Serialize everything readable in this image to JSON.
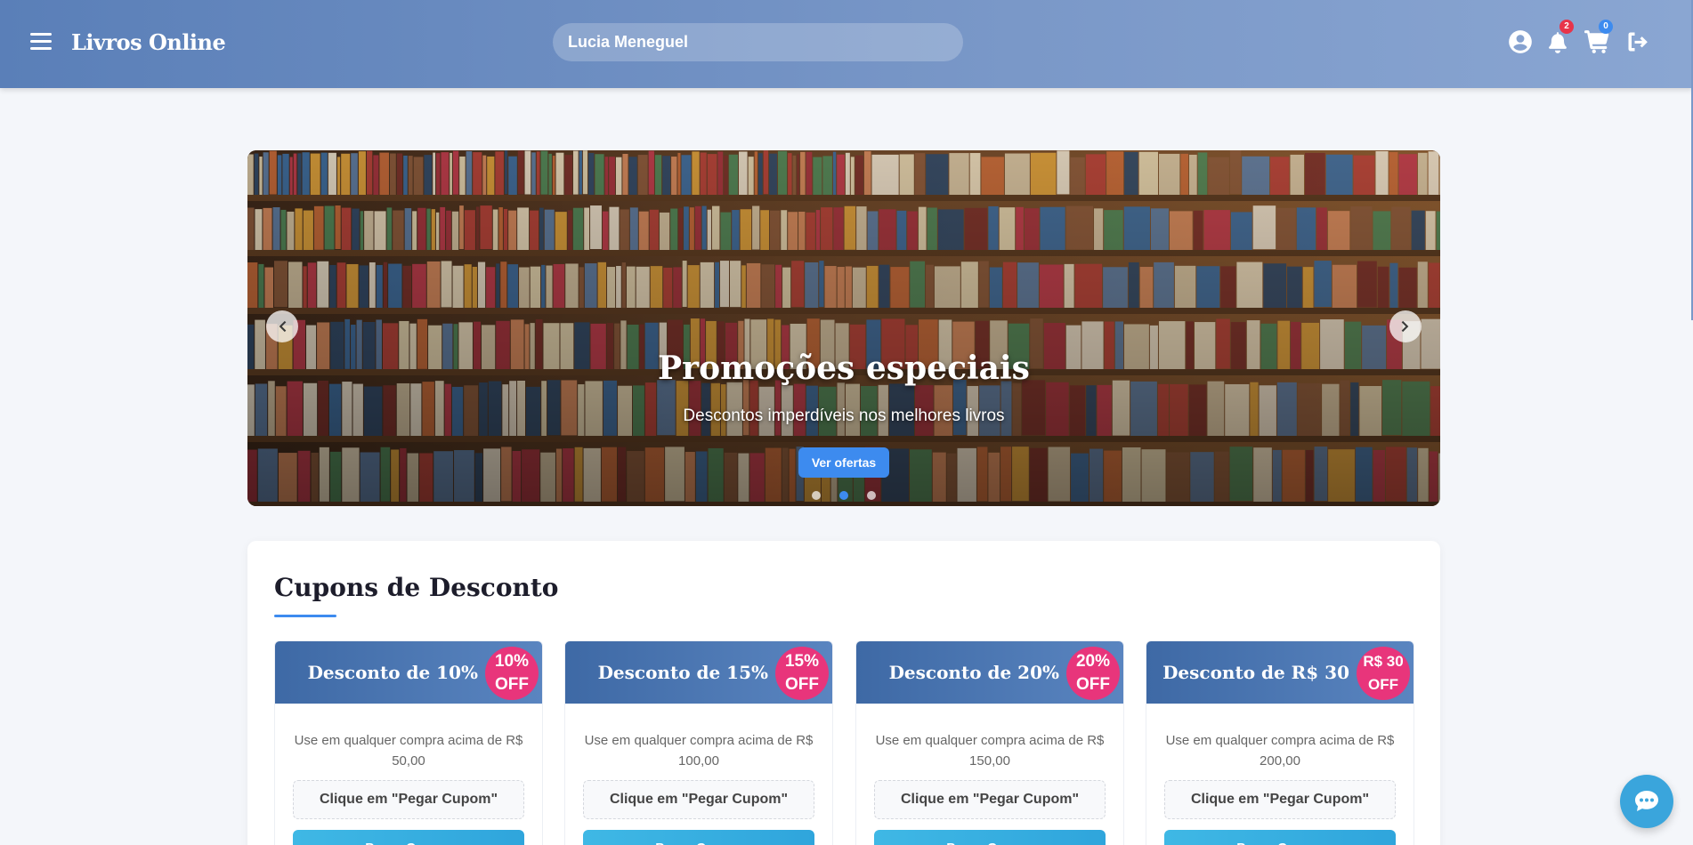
{
  "header": {
    "brand": "Livros Online",
    "search_value": "Lucia Meneguel",
    "notifications_count": "2",
    "cart_count": "0",
    "icons": [
      "user-icon",
      "bell-icon",
      "cart-icon",
      "logout-icon"
    ],
    "colors": {
      "notification_badge": "#e8344a",
      "cart_badge": "#3d8bef"
    }
  },
  "carousel": {
    "title": "Promoções especiais",
    "subtitle": "Descontos imperdíveis nos melhores livros",
    "button_label": "Ver ofertas",
    "active_slide": 1,
    "slide_count": 3
  },
  "coupons_section": {
    "title": "Cupons de Desconto",
    "items": [
      {
        "title": "Desconto de 10%",
        "badge_line1": "10%",
        "badge_line2": "OFF",
        "description": "Use em qualquer compra acima de R$ 50,00",
        "code_text": "Clique em \"Pegar Cupom\"",
        "button_label": "Pegar Cupom"
      },
      {
        "title": "Desconto de 15%",
        "badge_line1": "15%",
        "badge_line2": "OFF",
        "description": "Use em qualquer compra acima de R$ 100,00",
        "code_text": "Clique em \"Pegar Cupom\"",
        "button_label": "Pegar Cupom"
      },
      {
        "title": "Desconto de 20%",
        "badge_line1": "20%",
        "badge_line2": "OFF",
        "description": "Use em qualquer compra acima de R$ 150,00",
        "code_text": "Clique em \"Pegar Cupom\"",
        "button_label": "Pegar Cupom"
      },
      {
        "title": "Desconto de R$ 30",
        "badge_line1": "R$ 30",
        "badge_line2": "OFF",
        "description": "Use em qualquer compra acima de R$ 200,00",
        "code_text": "Clique em \"Pegar Cupom\"",
        "button_label": "Pegar Cupom"
      }
    ]
  },
  "colors": {
    "accent": "#3d8bef",
    "badge_pink": "#e8357b",
    "coupon_button": "#3aa5dc"
  }
}
